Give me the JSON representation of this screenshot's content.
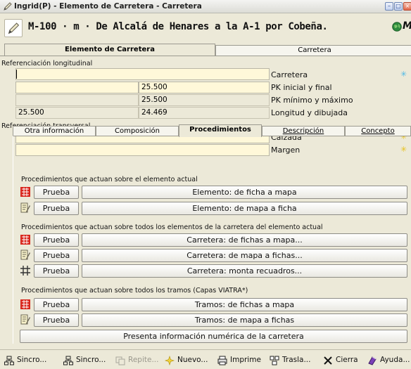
{
  "window": {
    "title": "Ingrid(P) - Elemento de Carretera - Carretera"
  },
  "header": {
    "title": "M-100 · m · De Alcalá de Henares a la A-1 por Cobeña.",
    "binoculars_glyph": "🔭"
  },
  "top_tabs": {
    "active": "Elemento de Carretera",
    "inactive": "Carretera"
  },
  "long_ref": {
    "label": "Referenciación longitudinal",
    "rows": [
      {
        "left": "",
        "right": "",
        "label": "Carretera"
      },
      {
        "left": "",
        "right": "25.500",
        "label": "PK inicial y final"
      },
      {
        "left": "",
        "right": "25.500",
        "label": "PK mínimo y máximo"
      },
      {
        "left": "25.500",
        "right": "24.469",
        "label": "Longitud y dibujada"
      }
    ]
  },
  "trans_ref": {
    "label": "Referenciación transversal",
    "rows": [
      {
        "label": "Calzada"
      },
      {
        "label": "Margen"
      }
    ]
  },
  "tabs": [
    {
      "label": "Otra información",
      "active": false
    },
    {
      "label": "Composición",
      "active": false
    },
    {
      "label": "Procedimientos",
      "active": true
    },
    {
      "label": "Descripción",
      "active": false
    },
    {
      "label": "Concepto",
      "active": false
    }
  ],
  "procedures": {
    "group1_label": "Procedimientos que actuan sobre el elemento actual",
    "group1": [
      {
        "icon": "sheet-to-map-icon",
        "test": "Prueba",
        "action": "Elemento: de ficha a mapa"
      },
      {
        "icon": "map-to-sheet-icon",
        "test": "Prueba",
        "action": "Elemento: de mapa a ficha"
      }
    ],
    "group2_label": "Procedimientos que actuan sobre todos los elementos de la carretera del elemento actual",
    "group2": [
      {
        "icon": "sheet-to-map-icon",
        "test": "Prueba",
        "action": "Carretera: de fichas a mapa..."
      },
      {
        "icon": "map-to-sheet-icon",
        "test": "Prueba",
        "action": "Carretera: de mapa a fichas..."
      },
      {
        "icon": "frame-grid-icon",
        "test": "Prueba",
        "action": "Carretera: monta recuadros..."
      }
    ],
    "group3_label": "Procedimientos que actuan sobre todos los tramos (Capas VIATRA*)",
    "group3": [
      {
        "icon": "sheet-to-map-icon",
        "test": "Prueba",
        "action": "Tramos: de fichas a mapa"
      },
      {
        "icon": "map-to-sheet-icon",
        "test": "Prueba",
        "action": "Tramos: de mapa a fichas"
      }
    ],
    "numeric_button": "Presenta información numérica de la carretera"
  },
  "bottom_bar": [
    {
      "icon": "sync-icon",
      "label": "Sincro...",
      "enabled": true
    },
    {
      "icon": "sync-icon",
      "label": "Sincro...",
      "enabled": true
    },
    {
      "icon": "repeat-icon",
      "label": "Repite...",
      "enabled": false
    },
    {
      "icon": "new-icon",
      "label": "Nuevo...",
      "enabled": true
    },
    {
      "icon": "print-icon",
      "label": "Imprime",
      "enabled": true
    },
    {
      "icon": "move-icon",
      "label": "Trasla...",
      "enabled": true
    },
    {
      "icon": "close-icon",
      "label": "Cierra",
      "enabled": true
    },
    {
      "icon": "help-icon",
      "label": "Ayuda...",
      "enabled": true
    }
  ],
  "colors": {
    "field_editable": "#fff8d9",
    "panel": "#ece9d8",
    "accent_red": "#d8261c"
  }
}
